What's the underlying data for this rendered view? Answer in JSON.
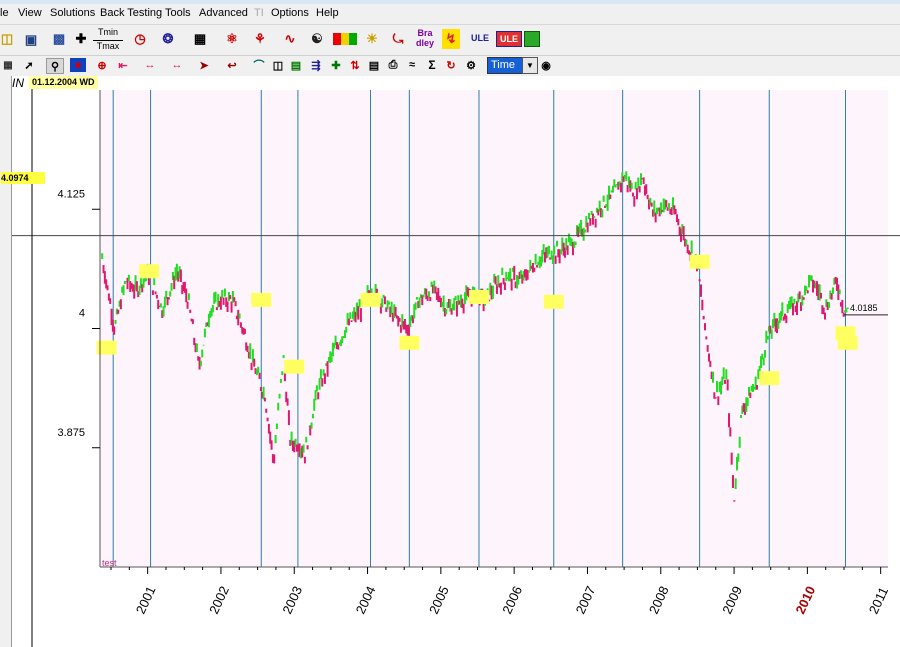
{
  "menu": {
    "items": [
      "le",
      "View",
      "Solutions",
      "Back Testing",
      "Tools",
      "Advanced",
      "TI",
      "Options",
      "Help"
    ]
  },
  "toolbar1": {
    "tmin_label": "Tmin",
    "tmax_label": "Tmax",
    "bradley_top": "Bra",
    "bradley_bottom": "dley",
    "ule_label": "ULE",
    "ule_box_label": "ULE"
  },
  "toolbar2": {
    "timeframe_value": "Time",
    "zoom_label": "IN"
  },
  "chart": {
    "date_badge": "01.12.2004 WD",
    "cursor_price": "4.0974",
    "last_price": "4.0185",
    "y_ticks": [
      "4.125",
      "4",
      "3.875"
    ],
    "x_years": [
      "2001",
      "2002",
      "2003",
      "2004",
      "2005",
      "2006",
      "2007",
      "2008",
      "2009",
      "2010",
      "2011"
    ],
    "highlight_year": "2010",
    "watermark": "test",
    "colors": {
      "background": "#fdf5fb",
      "up_bar": "#22dd22",
      "down_bar": "#e0186e",
      "cycle_line": "#2a7fa7",
      "marker": "#ffff60",
      "year_highlight": "#aa0000"
    }
  },
  "chart_data": {
    "type": "line",
    "ylim": [
      3.75,
      4.25
    ],
    "y_ticks": [
      4.125,
      4,
      3.875
    ],
    "x_start": 2000.35,
    "x_end": 2011.1,
    "horizontal_line": 4.0974,
    "last_value": 4.0185,
    "cycle_lines": [
      2000.53,
      2001.04,
      2002.55,
      2003.05,
      2004.04,
      2004.57,
      2005.52,
      2006.54,
      2007.48,
      2008.53,
      2009.48,
      2010.52
    ],
    "series": [
      {
        "x": [
          2000.38,
          2000.55,
          2000.7,
          2000.85,
          2001.0,
          2001.2,
          2001.4,
          2001.55,
          2001.7,
          2001.85,
          2002.0,
          2002.15,
          2002.3,
          2002.45,
          2002.6,
          2002.72,
          2002.85,
          2002.95,
          2003.05,
          2003.15,
          2003.3,
          2003.5,
          2003.7,
          2003.9,
          2004.05,
          2004.2,
          2004.4,
          2004.55,
          2004.7,
          2004.9,
          2005.1,
          2005.3,
          2005.45,
          2005.6,
          2005.75,
          2005.9,
          2006.1,
          2006.3,
          2006.5,
          2006.6,
          2006.8,
          2007.0,
          2007.2,
          2007.35,
          2007.5,
          2007.65,
          2007.75,
          2007.9,
          2008.05,
          2008.2,
          2008.35,
          2008.5,
          2008.6,
          2008.75,
          2008.9,
          2009.0,
          2009.1,
          2009.2,
          2009.3,
          2009.45,
          2009.6,
          2009.75,
          2009.9,
          2010.05,
          2010.15,
          2010.25,
          2010.4,
          2010.5,
          2010.55
        ],
        "values": [
          4.074,
          4.0,
          4.05,
          4.04,
          4.06,
          4.02,
          4.06,
          4.03,
          3.96,
          4.02,
          4.03,
          4.03,
          4.0,
          3.96,
          3.93,
          3.86,
          3.97,
          3.88,
          3.88,
          3.87,
          3.93,
          3.97,
          4.0,
          4.02,
          4.04,
          4.03,
          4.01,
          4.0,
          4.03,
          4.04,
          4.02,
          4.03,
          4.035,
          4.03,
          4.045,
          4.055,
          4.05,
          4.07,
          4.08,
          4.08,
          4.09,
          4.11,
          4.13,
          4.14,
          4.16,
          4.14,
          4.16,
          4.12,
          4.13,
          4.12,
          4.09,
          4.07,
          4.0,
          3.93,
          3.95,
          3.82,
          3.91,
          3.93,
          3.94,
          3.99,
          4.01,
          4.02,
          4.03,
          4.05,
          4.04,
          4.02,
          4.05,
          4.02,
          4.0185
        ]
      }
    ],
    "markers": [
      {
        "x": 2000.44,
        "y": 3.98
      },
      {
        "x": 2001.02,
        "y": 4.06
      },
      {
        "x": 2002.55,
        "y": 4.03
      },
      {
        "x": 2003.0,
        "y": 3.96
      },
      {
        "x": 2004.04,
        "y": 4.03
      },
      {
        "x": 2004.57,
        "y": 3.985
      },
      {
        "x": 2005.52,
        "y": 4.033
      },
      {
        "x": 2006.54,
        "y": 4.028
      },
      {
        "x": 2008.53,
        "y": 4.07
      },
      {
        "x": 2009.48,
        "y": 3.948
      },
      {
        "x": 2010.52,
        "y": 3.995
      },
      {
        "x": 2010.55,
        "y": 3.985
      }
    ]
  }
}
